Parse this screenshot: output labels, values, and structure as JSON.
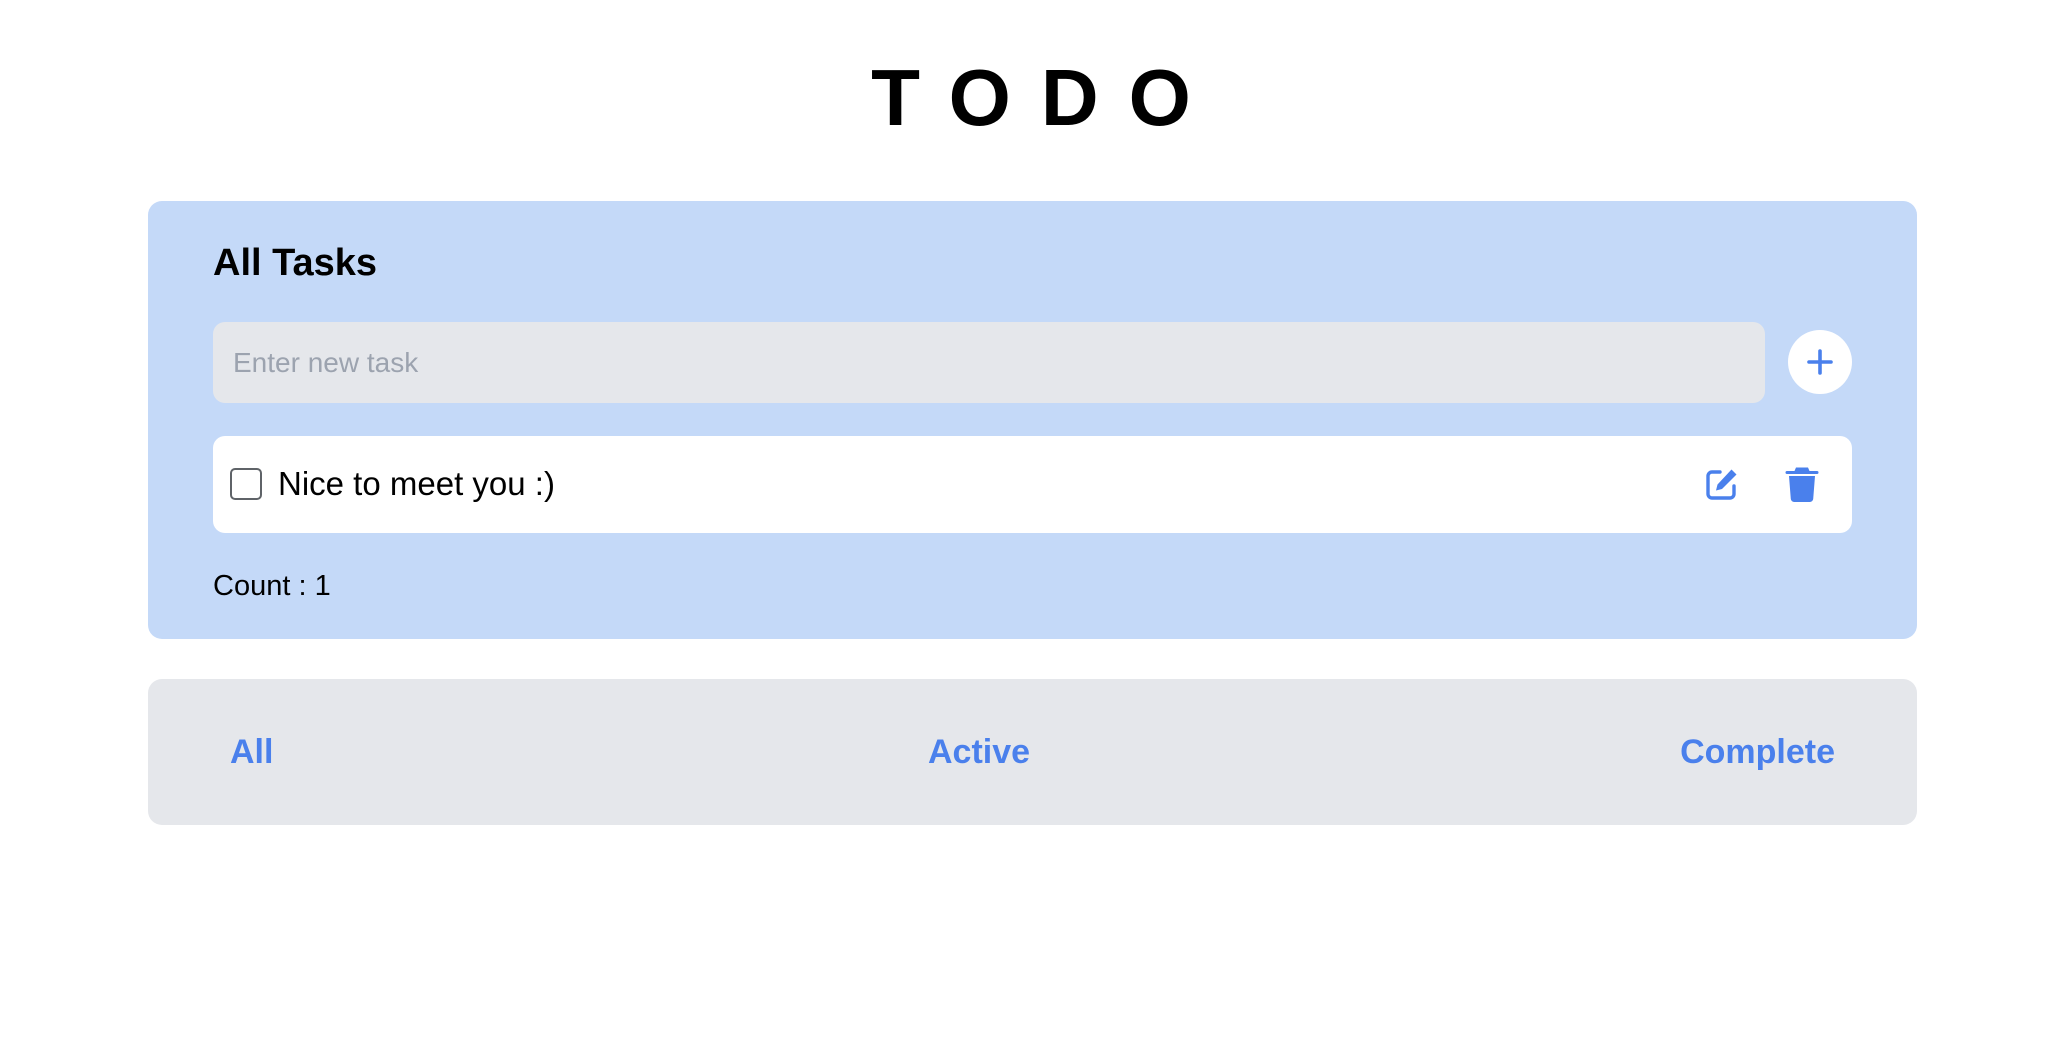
{
  "app": {
    "title": "TODO"
  },
  "task_panel": {
    "heading": "All Tasks",
    "input": {
      "placeholder": "Enter new task",
      "value": ""
    },
    "add_button_icon": "plus-icon",
    "tasks": [
      {
        "text": "Nice to meet you :)",
        "completed": false,
        "edit_icon": "edit-icon",
        "delete_icon": "trash-icon"
      }
    ],
    "count_label": "Count : ",
    "count_value": "1"
  },
  "filters": {
    "all_label": "All",
    "active_label": "Active",
    "complete_label": "Complete"
  },
  "colors": {
    "accent": "#4a80ec",
    "panel_background": "#c4d9f8",
    "input_background": "#e5e7eb",
    "filter_bar_background": "#e5e7eb"
  }
}
